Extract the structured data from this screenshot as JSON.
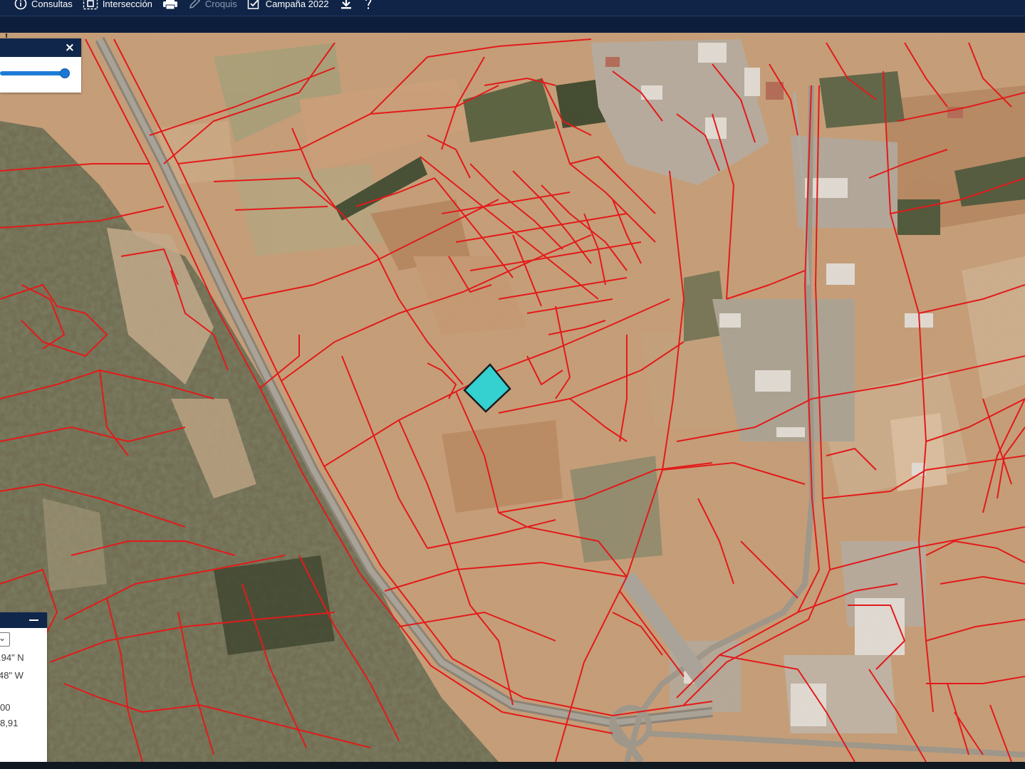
{
  "toolbar": {
    "consultas_label": "Consultas",
    "interseccion_label": "Intersección",
    "croquis_label": "Croquis",
    "campana_label": "Campaña 2022",
    "icons": [
      "info-icon",
      "intersection-icon",
      "print-icon",
      "pencil-icon",
      "checkbox-icon",
      "download-icon",
      "help-icon"
    ]
  },
  "coordinates": {
    "lat_text": ".94\" N",
    "lon_text": "48\" W",
    "line3_text": "00",
    "line4_text": "8,91"
  },
  "layer_panel": {
    "close_label": "×",
    "opacity_percent": 100
  },
  "colors": {
    "toolbar_bg": "#0f2447",
    "parcel_border": "#e31a1a",
    "selected_parcel_fill": "#35d0d0",
    "slider": "#1e7cd6"
  }
}
